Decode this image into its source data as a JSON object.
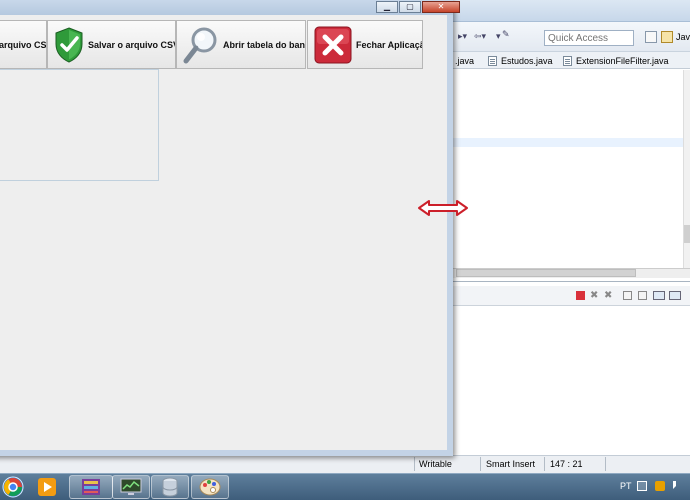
{
  "app": {
    "buttons": [
      {
        "id": "open",
        "label": "arquivo CSV",
        "icon": "folder-icon"
      },
      {
        "id": "save",
        "label": "Salvar o arquivo CSV",
        "icon": "green-shield-check-icon"
      },
      {
        "id": "open-db",
        "label": "Abrir tabela do banco",
        "icon": "magnifier-icon"
      },
      {
        "id": "close",
        "label": "Fechar Aplicação",
        "icon": "red-x-icon"
      }
    ],
    "window_controls": [
      "minimize",
      "maximize",
      "close"
    ]
  },
  "ide": {
    "quick_access_placeholder": "Quick Access",
    "perspective_label": "Java",
    "editor_tabs": [
      {
        "label": ".java"
      },
      {
        "label": "Estudos.java"
      },
      {
        "label": "ExtensionFileFilter.java"
      }
    ],
    "status": {
      "mode": "Writable",
      "insert": "Smart Insert",
      "position": "147 : 21"
    }
  },
  "taskbar": {
    "items": [
      "start-orb",
      "chrome",
      "media-player",
      "winrar",
      "system-monitor",
      "database",
      "paint"
    ],
    "tray": {
      "language": "PT"
    }
  },
  "colors": {
    "accent_red": "#cc2a3a",
    "shield_green": "#2f9a3a",
    "taskbar": "#4a6b8a"
  }
}
